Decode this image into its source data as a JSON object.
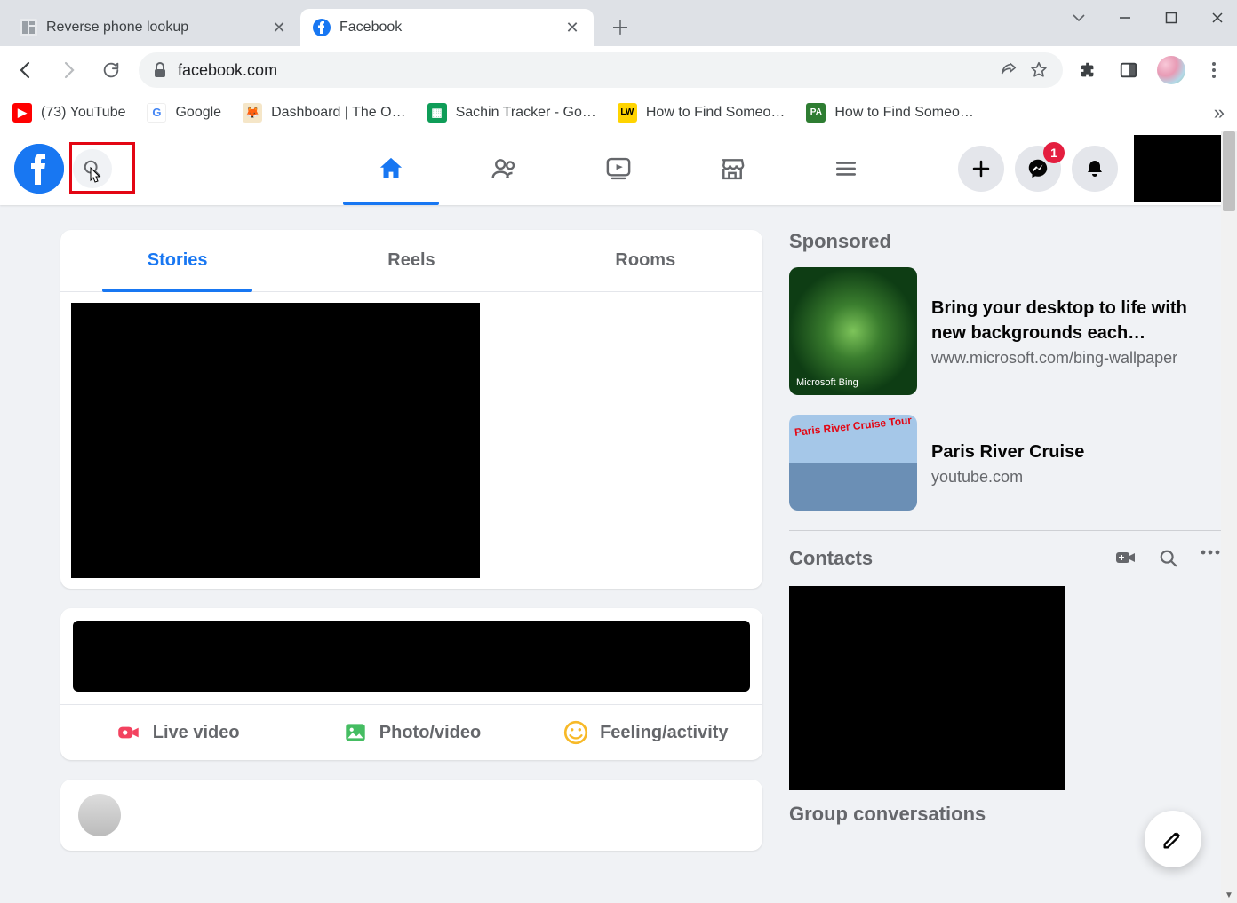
{
  "browser": {
    "tabs": [
      {
        "title": "Reverse phone lookup",
        "active": false
      },
      {
        "title": "Facebook",
        "active": true
      }
    ],
    "url": "facebook.com",
    "bookmarks": [
      {
        "label": "(73) YouTube",
        "icon_bg": "#ff0000",
        "icon_text": "▶"
      },
      {
        "label": "Google",
        "icon_bg": "#ffffff",
        "icon_text": "G"
      },
      {
        "label": "Dashboard | The O…",
        "icon_bg": "#f5deb3",
        "icon_text": "🦊"
      },
      {
        "label": "Sachin Tracker - Go…",
        "icon_bg": "#0f9d58",
        "icon_text": "▦"
      },
      {
        "label": "How to Find Someo…",
        "icon_bg": "#ffd400",
        "icon_text": "LW"
      },
      {
        "label": "How to Find Someo…",
        "icon_bg": "#2e7d32",
        "icon_text": "PA"
      }
    ]
  },
  "fb_header": {
    "messenger_badge": "1"
  },
  "stories_card": {
    "tabs": [
      "Stories",
      "Reels",
      "Rooms"
    ],
    "active_tab": 0
  },
  "composer": {
    "actions": [
      {
        "label": "Live video",
        "color": "#f3425f"
      },
      {
        "label": "Photo/video",
        "color": "#45bd62"
      },
      {
        "label": "Feeling/activity",
        "color": "#f7b928"
      }
    ]
  },
  "right": {
    "sponsored_label": "Sponsored",
    "ads": [
      {
        "title": "Bring your desktop to life with new backgrounds each…",
        "domain": "www.microsoft.com/bing-wallpaper",
        "tag": "Microsoft Bing"
      },
      {
        "title": "Paris River Cruise",
        "domain": "youtube.com",
        "tag": "Paris River Cruise Tour"
      }
    ],
    "contacts_label": "Contacts",
    "group_conv_label": "Group conversations"
  }
}
